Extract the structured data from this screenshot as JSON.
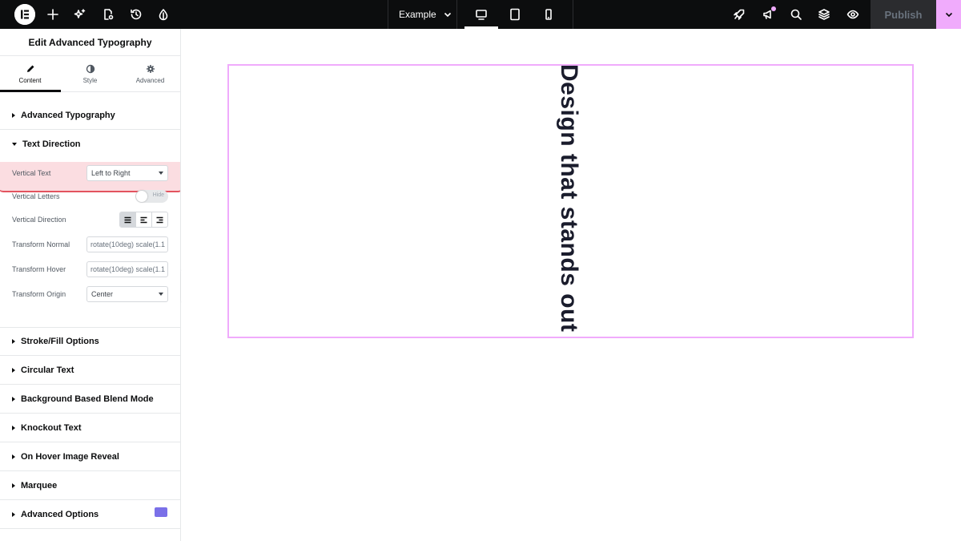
{
  "topbar": {
    "page_name": "Example",
    "publish_label": "Publish"
  },
  "panel": {
    "title": "Edit Advanced Typography",
    "tabs": [
      {
        "label": "Content",
        "icon": "pencil-icon"
      },
      {
        "label": "Style",
        "icon": "contrast-icon"
      },
      {
        "label": "Advanced",
        "icon": "gear-icon"
      }
    ],
    "sections_top": [
      {
        "label": "Advanced Typography"
      },
      {
        "label": "Text Direction"
      }
    ],
    "controls": {
      "vertical_text": {
        "label": "Vertical Text",
        "value": "Left to Right"
      },
      "vertical_letters": {
        "label": "Vertical Letters",
        "toggle": "Hide"
      },
      "vertical_direction": {
        "label": "Vertical Direction"
      },
      "transform_normal": {
        "label": "Transform Normal",
        "value": "rotate(10deg) scale(1.1"
      },
      "transform_hover": {
        "label": "Transform Hover",
        "value": "rotate(10deg) scale(1.1"
      },
      "transform_origin": {
        "label": "Transform Origin",
        "value": "Center"
      }
    },
    "sections_bottom": [
      {
        "label": "Stroke/Fill Options"
      },
      {
        "label": "Circular Text"
      },
      {
        "label": "Background Based Blend Mode"
      },
      {
        "label": "Knockout Text"
      },
      {
        "label": "On Hover Image Reveal"
      },
      {
        "label": "Marquee"
      },
      {
        "label": "Advanced Options"
      }
    ]
  },
  "canvas": {
    "heading": "Design that stands out"
  },
  "colors": {
    "topbar_bg": "#0c0d0e",
    "accent_pink": "#f0abfc",
    "highlight_red": "#e3545f"
  }
}
